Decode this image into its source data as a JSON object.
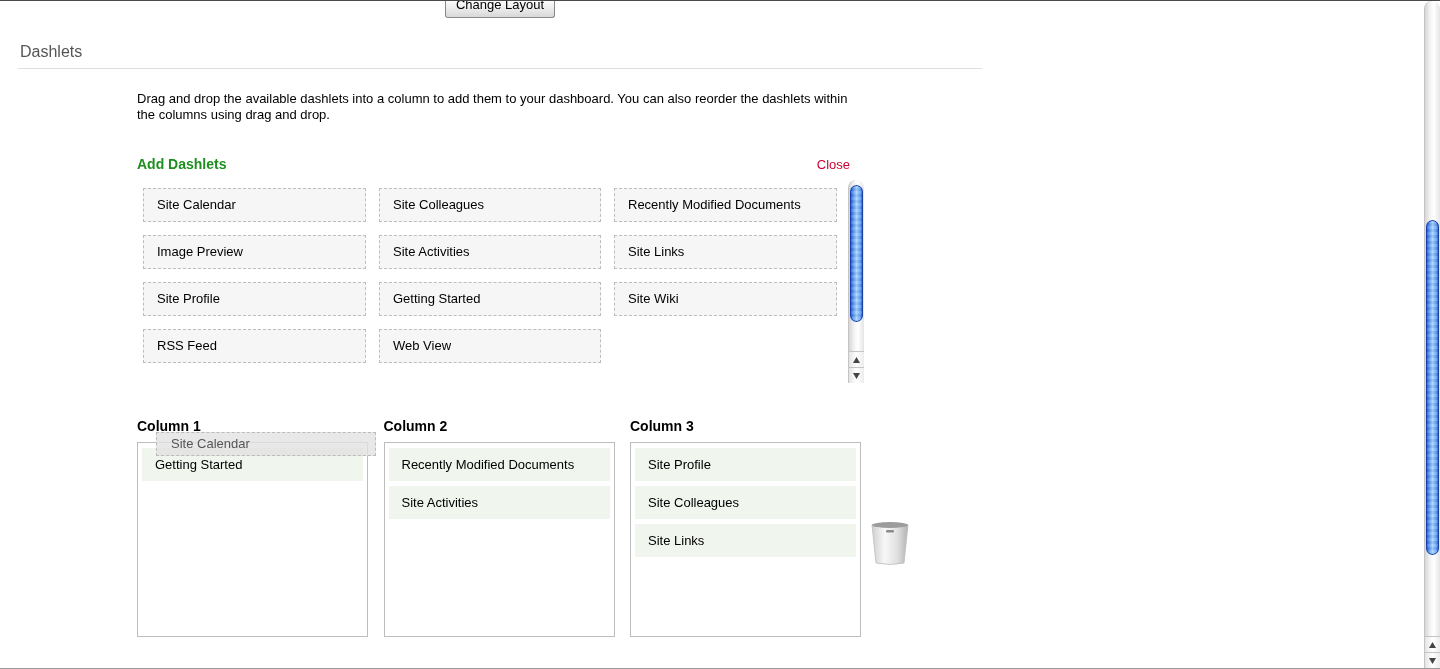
{
  "top_bar": {
    "button": "Change Layout"
  },
  "section": {
    "title": "Dashlets"
  },
  "instructions": "Drag and drop the available dashlets into a column to add them to your dashboard. You can also reorder the dashlets within the columns using drag and drop.",
  "add_dashlets": {
    "title": "Add Dashlets",
    "close_link": "Close",
    "dashlets": [
      "Site Calendar",
      "Site Colleagues",
      "Recently Modified Documents",
      "Image Preview",
      "Site Activities",
      "Site Links",
      "Site Profile",
      "Getting Started",
      "Site Wiki",
      "RSS Feed",
      "Web View"
    ]
  },
  "columns": [
    {
      "title": "Column 1",
      "dashlets": [
        "Getting Started"
      ]
    },
    {
      "title": "Column 2",
      "dashlets": [
        "Recently Modified Documents",
        "Site Activities"
      ]
    },
    {
      "title": "Column 3",
      "dashlets": [
        "Site Profile",
        "Site Colleagues",
        "Site Links"
      ]
    }
  ],
  "dragged_dashlet": {
    "label": "Site Calendar"
  }
}
